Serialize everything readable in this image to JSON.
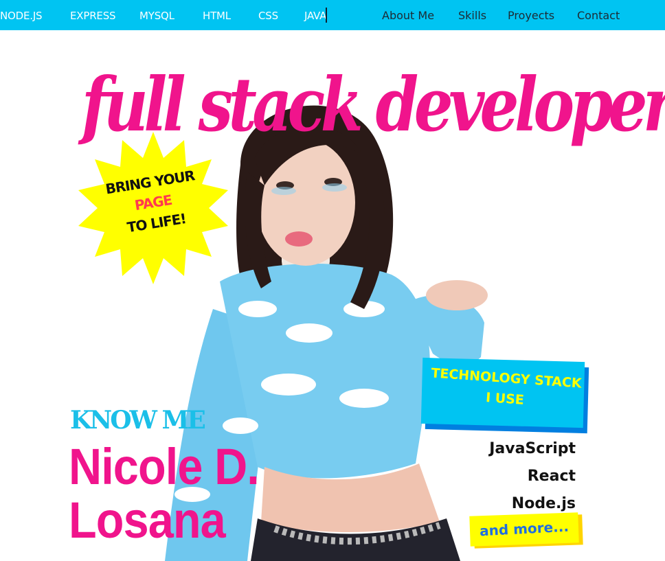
{
  "colors": {
    "accent_cyan": "#00c4f2",
    "accent_pink": "#f0148c",
    "accent_yellow": "#ffff00",
    "ink": "#111111"
  },
  "ticker": {
    "items": [
      "NODE.JS",
      "EXPRESS",
      "MYSQL",
      "HTML",
      "CSS",
      "JAVA"
    ]
  },
  "nav": {
    "links": [
      "About Me",
      "Skills",
      "Proyects",
      "Contact"
    ]
  },
  "hero": {
    "headline": "full stack developer",
    "photo_icon": "portrait-photo",
    "badge": {
      "line1": "BRING YOUR",
      "line2": "PAGE",
      "line3": "TO LIFE!"
    }
  },
  "intro": {
    "kicker": "KNOW ME",
    "first_name": "Nicole D.",
    "last_name": "Losana"
  },
  "tech_stack": {
    "title_line1": "TECHNOLOGY STACK",
    "title_line2": "I USE",
    "items": [
      "JavaScript",
      "React",
      "Node.js"
    ],
    "more": "and more..."
  }
}
